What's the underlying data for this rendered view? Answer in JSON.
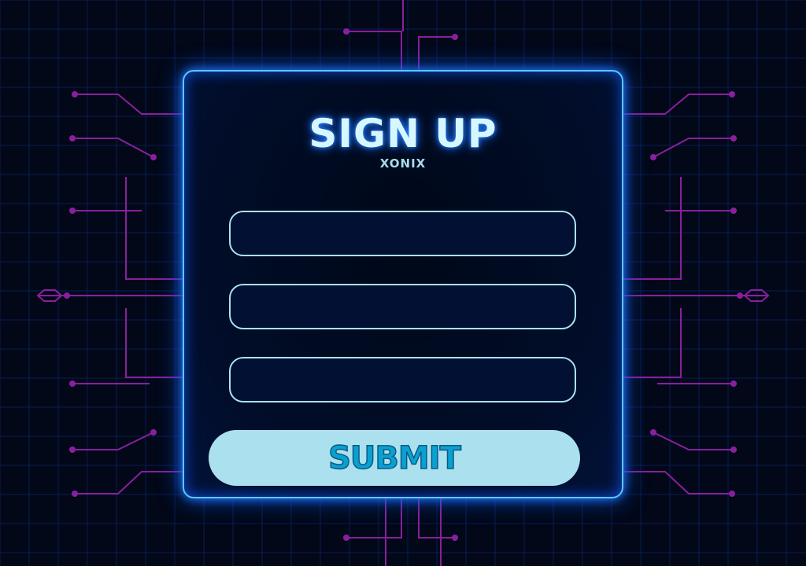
{
  "form": {
    "title": "SIGN UP",
    "brand": "XONIX",
    "fields": [
      {
        "value": "",
        "placeholder": ""
      },
      {
        "value": "",
        "placeholder": ""
      },
      {
        "value": "",
        "placeholder": ""
      }
    ],
    "submit_label": "SUBMIT"
  },
  "colors": {
    "background": "#020818",
    "grid": "#0d2470",
    "circuit": "#8a1f9e",
    "card_border": "#5fc6ff",
    "button_bg": "#abe0ef",
    "button_text": "#0aa0d2"
  }
}
